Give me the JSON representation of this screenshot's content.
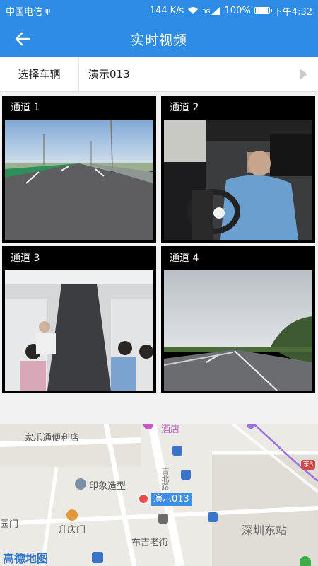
{
  "status_bar": {
    "carrier": "中国电信",
    "speed": "144 K/s",
    "network": "3G",
    "battery_pct": "100%",
    "battery_level": 1.0,
    "time": "下午4:32"
  },
  "header": {
    "title": "实时视频"
  },
  "selector": {
    "label": "选择车辆",
    "value": "演示013"
  },
  "channels": [
    {
      "label": "通道 1"
    },
    {
      "label": "通道 2"
    },
    {
      "label": "通道 3"
    },
    {
      "label": "通道 4"
    }
  ],
  "map": {
    "vehicle_label": "演示013",
    "pois": {
      "store": "家乐通便利店",
      "hotel": "酒店",
      "salon": "印象造型",
      "gate": "升庆门",
      "park": "园门",
      "street": "布吉老街",
      "station": "深圳东站",
      "road": "吉北路",
      "east_marker": "东3"
    },
    "logo": "高德地图"
  },
  "colors": {
    "primary": "#2f8ce6",
    "map_bg": "#eceae4",
    "vehicle_label_bg": "#3e8de6"
  }
}
